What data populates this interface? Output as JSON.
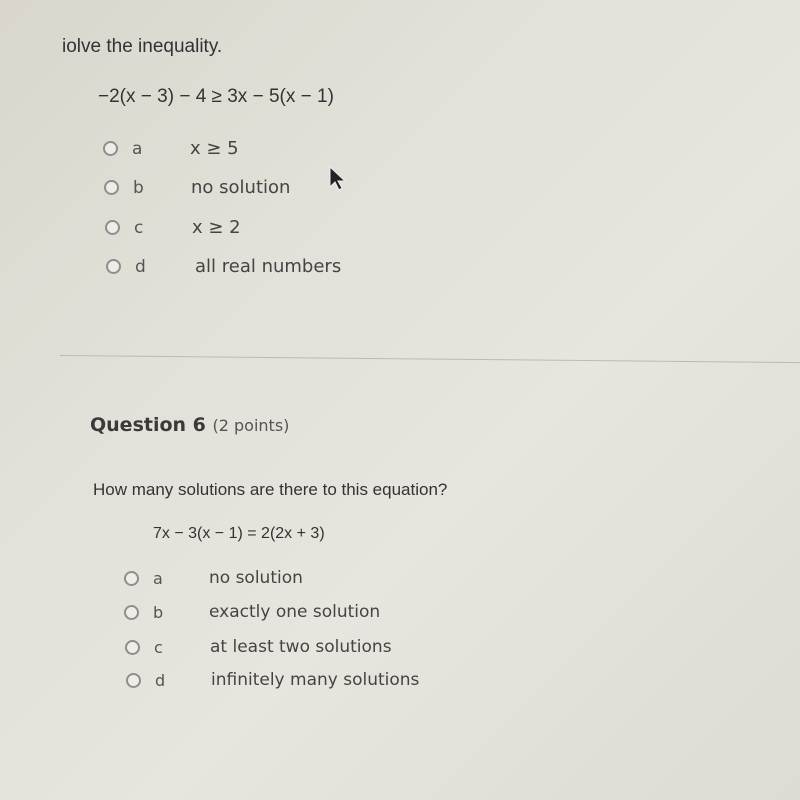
{
  "question5": {
    "prompt": "Solve the inequality.",
    "prompt_visible": "iolve the inequality.",
    "expression": "−2(x − 3) − 4 ≥ 3x − 5(x − 1)",
    "options": [
      {
        "letter": "a",
        "text": "x ≥ 5"
      },
      {
        "letter": "b",
        "text": "no solution"
      },
      {
        "letter": "c",
        "text": "x ≥ 2"
      },
      {
        "letter": "d",
        "text": "all real numbers"
      }
    ]
  },
  "question6": {
    "title": "Question 6",
    "points": "(2 points)",
    "prompt": "How many solutions are there to this equation?",
    "expression": "7x − 3(x − 1) = 2(2x + 3)",
    "options": [
      {
        "letter": "a",
        "text": "no solution"
      },
      {
        "letter": "b",
        "text": "exactly one solution"
      },
      {
        "letter": "c",
        "text": "at least two solutions"
      },
      {
        "letter": "d",
        "text": "infinitely many solutions"
      }
    ]
  }
}
